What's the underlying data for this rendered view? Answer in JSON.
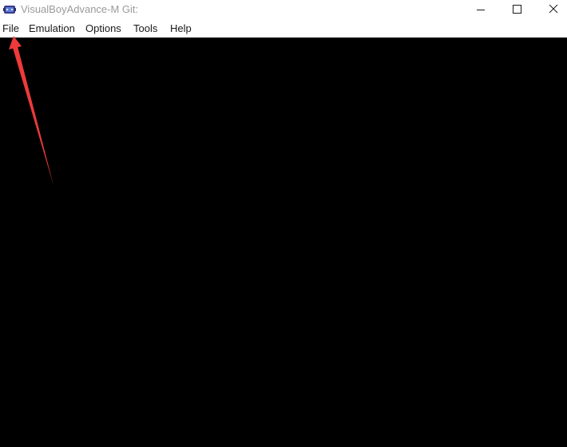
{
  "window": {
    "title": "VisualBoyAdvance-M Git:"
  },
  "icons": {
    "app": "gamepad-app-icon",
    "minimize": "minimize-icon",
    "maximize": "maximize-icon",
    "close": "close-icon"
  },
  "menubar": {
    "items": [
      {
        "label": "File"
      },
      {
        "label": "Emulation"
      },
      {
        "label": "Options"
      },
      {
        "label": "Tools"
      },
      {
        "label": "Help"
      }
    ]
  },
  "colors": {
    "viewport": "#000000",
    "annotation_arrow": "#ee3a3a"
  }
}
